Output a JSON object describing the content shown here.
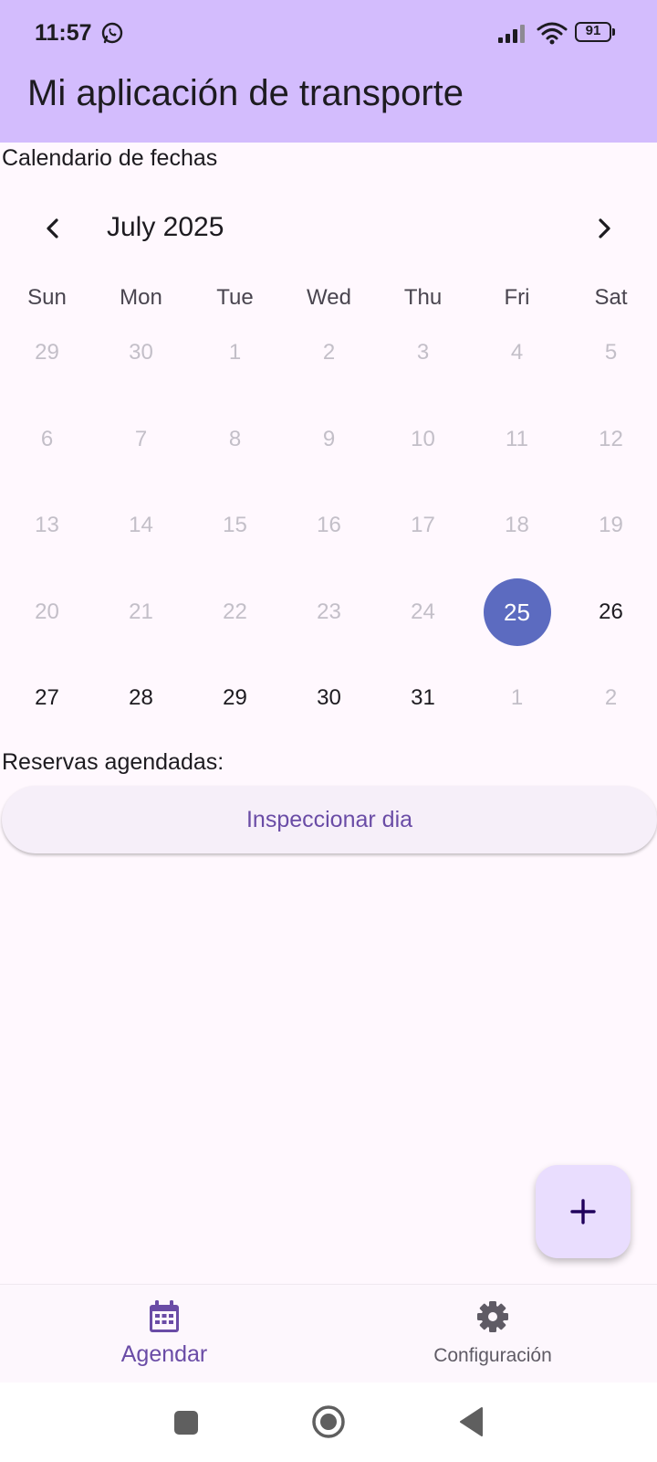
{
  "status_bar": {
    "time": "11:57",
    "battery": "91",
    "icons": [
      "whatsapp-icon",
      "signal-icon",
      "wifi-icon",
      "battery-icon"
    ]
  },
  "app": {
    "title": "Mi aplicación de transporte"
  },
  "calendar_section": {
    "label": "Calendario de fechas",
    "month": "July 2025",
    "prev_icon": "chevron-left-icon",
    "next_icon": "chevron-right-icon",
    "weekdays": [
      "Sun",
      "Mon",
      "Tue",
      "Wed",
      "Thu",
      "Fri",
      "Sat"
    ],
    "weeks": [
      [
        {
          "d": "29",
          "s": "muted"
        },
        {
          "d": "30",
          "s": "muted"
        },
        {
          "d": "1",
          "s": "muted"
        },
        {
          "d": "2",
          "s": "muted"
        },
        {
          "d": "3",
          "s": "muted"
        },
        {
          "d": "4",
          "s": "muted"
        },
        {
          "d": "5",
          "s": "muted"
        }
      ],
      [
        {
          "d": "6",
          "s": "muted"
        },
        {
          "d": "7",
          "s": "muted"
        },
        {
          "d": "8",
          "s": "muted"
        },
        {
          "d": "9",
          "s": "muted"
        },
        {
          "d": "10",
          "s": "muted"
        },
        {
          "d": "11",
          "s": "muted"
        },
        {
          "d": "12",
          "s": "muted"
        }
      ],
      [
        {
          "d": "13",
          "s": "muted"
        },
        {
          "d": "14",
          "s": "muted"
        },
        {
          "d": "15",
          "s": "muted"
        },
        {
          "d": "16",
          "s": "muted"
        },
        {
          "d": "17",
          "s": "muted"
        },
        {
          "d": "18",
          "s": "muted"
        },
        {
          "d": "19",
          "s": "muted"
        }
      ],
      [
        {
          "d": "20",
          "s": "muted"
        },
        {
          "d": "21",
          "s": "muted"
        },
        {
          "d": "22",
          "s": "muted"
        },
        {
          "d": "23",
          "s": "muted"
        },
        {
          "d": "24",
          "s": "muted"
        },
        {
          "d": "25",
          "s": "selected"
        },
        {
          "d": "26",
          "s": "active"
        }
      ],
      [
        {
          "d": "27",
          "s": "active"
        },
        {
          "d": "28",
          "s": "active"
        },
        {
          "d": "29",
          "s": "active"
        },
        {
          "d": "30",
          "s": "active"
        },
        {
          "d": "31",
          "s": "active"
        },
        {
          "d": "1",
          "s": "muted"
        },
        {
          "d": "2",
          "s": "muted"
        }
      ]
    ]
  },
  "reservations": {
    "label": "Reservas agendadas:",
    "inspect_button": "Inspeccionar dia"
  },
  "fab": {
    "icon": "plus-icon"
  },
  "bottom_nav": {
    "items": [
      {
        "label": "Agendar",
        "icon": "calendar-icon",
        "active": true
      },
      {
        "label": "Configuración",
        "icon": "gear-icon",
        "active": false
      }
    ]
  },
  "system_nav": {
    "icons": [
      "recents-square-icon",
      "home-circle-icon",
      "back-triangle-icon"
    ]
  },
  "colors": {
    "app_bar": "#d3bcfd",
    "background": "#fff8fe",
    "selected_day": "#5c6bc0",
    "primary_text": "#6a4ca6",
    "fab": "#e9ddfe"
  }
}
